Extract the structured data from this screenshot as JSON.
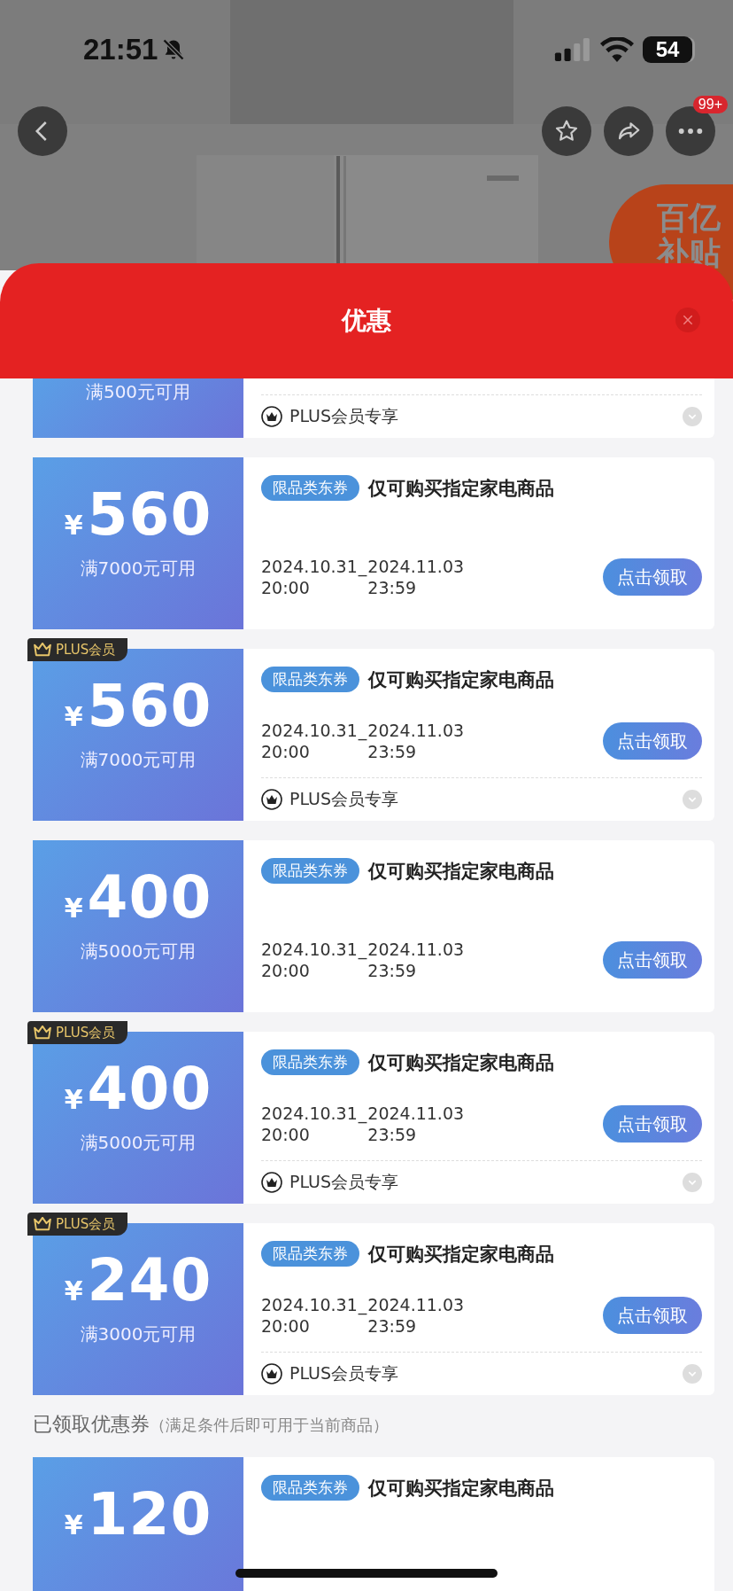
{
  "status_bar": {
    "time": "21:51",
    "battery": "54"
  },
  "nav": {
    "badge": "99+"
  },
  "subsidy_badge": {
    "line1": "百亿",
    "line2": "补贴"
  },
  "sheet": {
    "title": "优惠"
  },
  "coupons": [
    {
      "kind": "bottom_part",
      "condition": "满500元可用",
      "plus_note": "PLUS会员专享"
    },
    {
      "kind": "full",
      "currency": "¥",
      "amount": "560",
      "condition": "满7000元可用",
      "tag": "限品类东券",
      "title": "仅可购买指定家电商品",
      "start_date": "2024.10.31",
      "start_time": "20:00",
      "separator": "_",
      "end_date": "2024.11.03",
      "end_time": "23:59",
      "button": "点击领取"
    },
    {
      "kind": "full",
      "plus_badge": "PLUS会员",
      "currency": "¥",
      "amount": "560",
      "condition": "满7000元可用",
      "tag": "限品类东券",
      "title": "仅可购买指定家电商品",
      "start_date": "2024.10.31",
      "start_time": "20:00",
      "separator": "_",
      "end_date": "2024.11.03",
      "end_time": "23:59",
      "button": "点击领取",
      "plus_note": "PLUS会员专享"
    },
    {
      "kind": "full",
      "currency": "¥",
      "amount": "400",
      "condition": "满5000元可用",
      "tag": "限品类东券",
      "title": "仅可购买指定家电商品",
      "start_date": "2024.10.31",
      "start_time": "20:00",
      "separator": "_",
      "end_date": "2024.11.03",
      "end_time": "23:59",
      "button": "点击领取"
    },
    {
      "kind": "full",
      "plus_badge": "PLUS会员",
      "currency": "¥",
      "amount": "400",
      "condition": "满5000元可用",
      "tag": "限品类东券",
      "title": "仅可购买指定家电商品",
      "start_date": "2024.10.31",
      "start_time": "20:00",
      "separator": "_",
      "end_date": "2024.11.03",
      "end_time": "23:59",
      "button": "点击领取",
      "plus_note": "PLUS会员专享"
    },
    {
      "kind": "full",
      "plus_badge": "PLUS会员",
      "currency": "¥",
      "amount": "240",
      "condition": "满3000元可用",
      "tag": "限品类东券",
      "title": "仅可购买指定家电商品",
      "start_date": "2024.10.31",
      "start_time": "20:00",
      "separator": "_",
      "end_date": "2024.11.03",
      "end_time": "23:59",
      "button": "点击领取",
      "plus_note": "PLUS会员专享"
    }
  ],
  "claimed_section": {
    "title": "已领取优惠券",
    "note": "（满足条件后即可用于当前商品）"
  },
  "claimed_coupons": [
    {
      "kind": "top_part",
      "currency": "¥",
      "amount": "120",
      "tag": "限品类东券",
      "title": "仅可购买指定家电商品"
    }
  ]
}
